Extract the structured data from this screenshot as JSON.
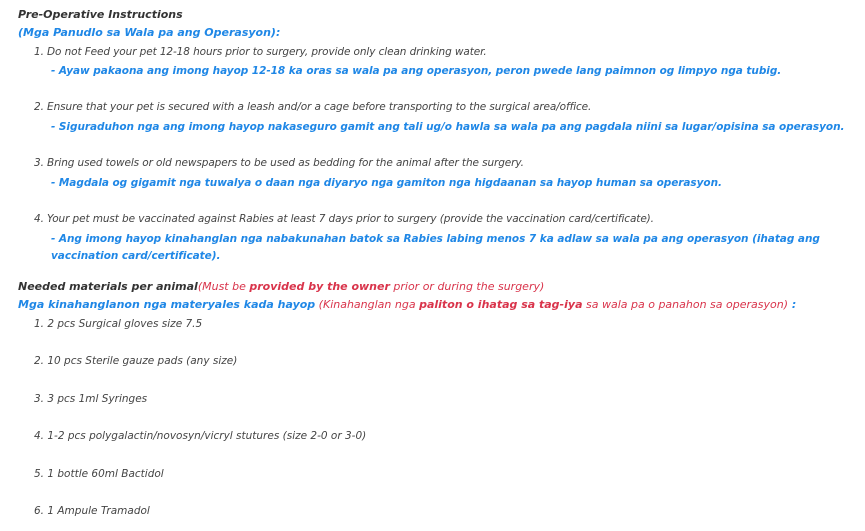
{
  "pre_op": {
    "title": "Pre-Operative Instructions",
    "title_local": "(Mga Panudlo sa Wala pa ang Operasyon):",
    "items": [
      {
        "en": "1. Do not Feed your pet 12-18 hours prior to surgery, provide only clean drinking water.",
        "local": "- Ayaw pakaona ang imong hayop 12-18 ka oras sa wala pa ang operasyon, peron pwede lang paimnon og limpyo nga tubig."
      },
      {
        "en": "2. Ensure that your pet is secured with a leash and/or a cage before transporting to the surgical area/office.",
        "local": "- Siguraduhon nga ang imong hayop nakaseguro gamit ang tali ug/o hawla sa wala pa ang pagdala niini sa lugar/opisina sa operasyon."
      },
      {
        "en": "3. Bring used towels or old newspapers to be used as bedding for the animal after the surgery.",
        "local": "- Magdala og gigamit nga tuwalya o daan nga diyaryo nga gamiton nga higdaanan sa hayop human sa operasyon."
      },
      {
        "en": "4. Your pet must be vaccinated against Rabies at least 7 days prior to surgery (provide the vaccination card/certificate).",
        "local_line1": "- Ang imong hayop kinahanglan nga nabakunahan batok sa Rabies labing menos 7 ka adlaw sa wala pa ang operasyon (ihatag ang",
        "local_line2": "vaccination card/certificate)."
      }
    ]
  },
  "materials": {
    "title": "Needed materials per animal",
    "note_pre": "(Must be ",
    "note_emph": "provided by the owner",
    "note_post": " prior or during the surgery)",
    "title_local": "Mga kinahanglanon nga materyales kada hayop",
    "note_local_pre": " (Kinahanglan nga ",
    "note_local_emph": "paliton o ihatag sa tag-iya",
    "note_local_post": " sa wala pa o panahon sa operasyon)",
    "note_local_colon": " :",
    "items": [
      "1. 2 pcs Surgical gloves size 7.5",
      "2. 10 pcs Sterile gauze pads (any size)",
      "3. 3 pcs 1ml Syringes",
      "4. 1-2 pcs polygalactin/novosyn/vicryl stutures (size 2-0 or 3-0)",
      "5. 1 bottle 60ml Bactidol",
      "6. 1 Ampule Tramadol"
    ]
  },
  "colors": {
    "text": "#333333",
    "blue": "#1f87e6",
    "red": "#d9344b"
  }
}
